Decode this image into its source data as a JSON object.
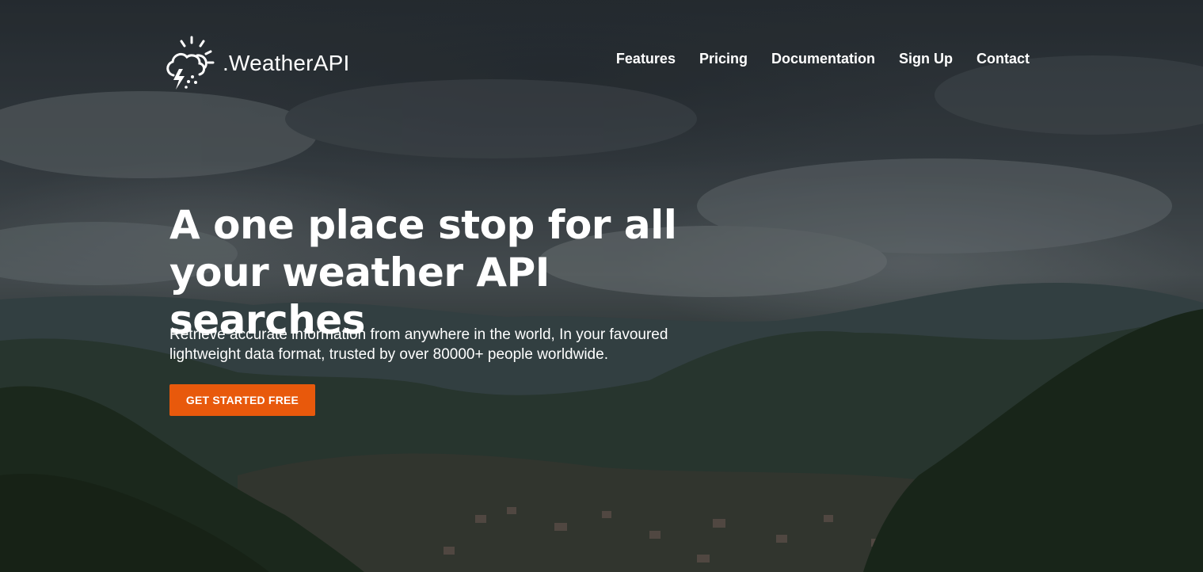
{
  "brand": {
    "name": ".WeatherAPI",
    "icon": "cloud-sun-lightning-icon"
  },
  "nav": {
    "items": [
      {
        "label": "Features"
      },
      {
        "label": "Pricing"
      },
      {
        "label": "Documentation"
      },
      {
        "label": "Sign Up"
      },
      {
        "label": "Contact"
      }
    ]
  },
  "hero": {
    "headline": "A one place stop for all your weather API searches",
    "subtext": "Retrieve accurate information from anywhere in the world, In your favoured lightweight data format, trusted by over 80000+ people worldwide.",
    "cta_label": "GET STARTED FREE",
    "background": "cloudy-mountain-valley-town-photo"
  },
  "colors": {
    "accent": "#e8590c",
    "text": "#ffffff"
  }
}
